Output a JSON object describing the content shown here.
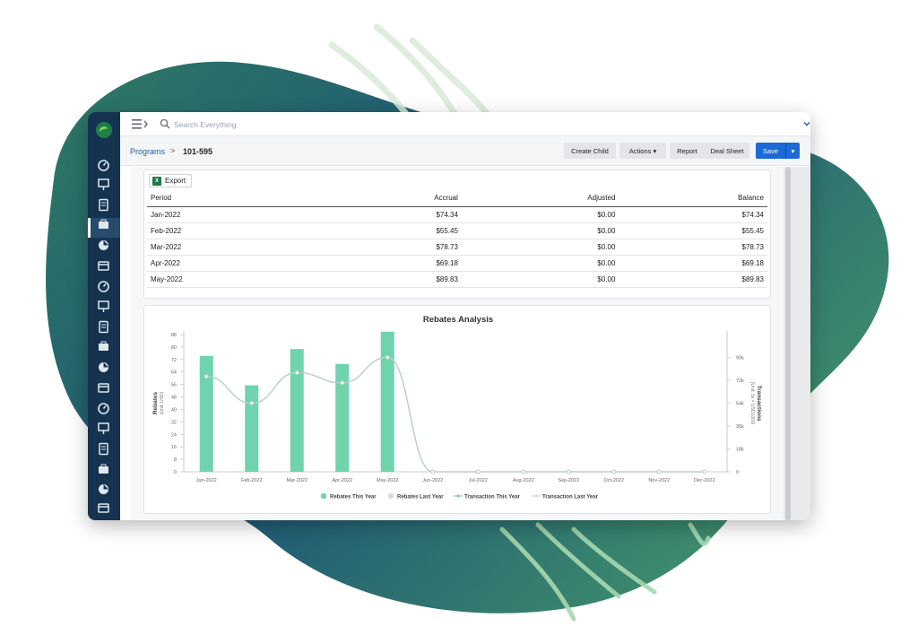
{
  "topbar": {
    "search_placeholder": "Search Everything"
  },
  "breadcrumb": {
    "programs": "Programs",
    "separator": ">",
    "current": "101-595"
  },
  "toolbar": {
    "create_child": "Create Child",
    "actions": "Actions ▾",
    "report": "Report",
    "deal_sheet": "Deal Sheet",
    "save": "Save",
    "save_caret": "▾"
  },
  "table": {
    "export_label": "Export",
    "columns": [
      "Period",
      "Accrual",
      "Adjusted",
      "Balance"
    ],
    "rows": [
      [
        "Jan-2022",
        "$74.34",
        "$0.00",
        "$74.34"
      ],
      [
        "Feb-2022",
        "$55.45",
        "$0.00",
        "$55.45"
      ],
      [
        "Mar-2022",
        "$78.73",
        "$0.00",
        "$78.73"
      ],
      [
        "Apr-2022",
        "$69.18",
        "$0.00",
        "$69.18"
      ],
      [
        "May-2022",
        "$89.83",
        "$0.00",
        "$89.83"
      ]
    ]
  },
  "colors": {
    "brand_blue": "#1c6ad6",
    "rail": "#15334f",
    "bar": "#6fd4ae",
    "line": "#b7cfc6"
  },
  "chart_data": {
    "type": "bar",
    "title": "Rebates Analysis",
    "ylabel": "Rebates",
    "ylabel_unit": "(Unit: USD)",
    "y2label": "Transactions",
    "y2label_unit": "(Unit: 1k = USD1000)",
    "categories": [
      "Jan-2022",
      "Feb-2022",
      "Mar-2022",
      "Apr-2022",
      "May-2022",
      "Jun-2022",
      "Jul-2022",
      "Aug-2022",
      "Sep-2022",
      "Oct-2022",
      "Nov-2022",
      "Dec-2022"
    ],
    "ylim": [
      0,
      88
    ],
    "yticks": [
      0,
      8,
      16,
      24,
      32,
      40,
      48,
      56,
      64,
      72,
      80,
      88
    ],
    "y2lim": [
      0,
      108000
    ],
    "y2ticks": [
      {
        "v": 0,
        "label": "0"
      },
      {
        "v": 18000,
        "label": "18k"
      },
      {
        "v": 36000,
        "label": "36k"
      },
      {
        "v": 54000,
        "label": "54k"
      },
      {
        "v": 72000,
        "label": "72k"
      },
      {
        "v": 90000,
        "label": "90k"
      }
    ],
    "series": [
      {
        "name": "Rebates This Year",
        "kind": "bar",
        "axis": "y",
        "values": [
          74.34,
          55.45,
          78.73,
          69.18,
          89.83,
          0,
          0,
          0,
          0,
          0,
          0,
          0
        ]
      },
      {
        "name": "Rebates Last Year",
        "kind": "bar",
        "axis": "y",
        "values": [
          0,
          0,
          0,
          0,
          0,
          0,
          0,
          0,
          0,
          0,
          0,
          0
        ]
      },
      {
        "name": "Transaction This Year",
        "kind": "line",
        "axis": "y2",
        "values": [
          75000,
          54000,
          78000,
          70000,
          90000,
          0,
          0,
          0,
          0,
          0,
          0,
          0
        ]
      },
      {
        "name": "Transaction Last Year",
        "kind": "line",
        "axis": "y2",
        "values": [
          0,
          0,
          0,
          0,
          0,
          0,
          0,
          0,
          0,
          0,
          0,
          0
        ]
      }
    ],
    "legend": "bottom"
  }
}
